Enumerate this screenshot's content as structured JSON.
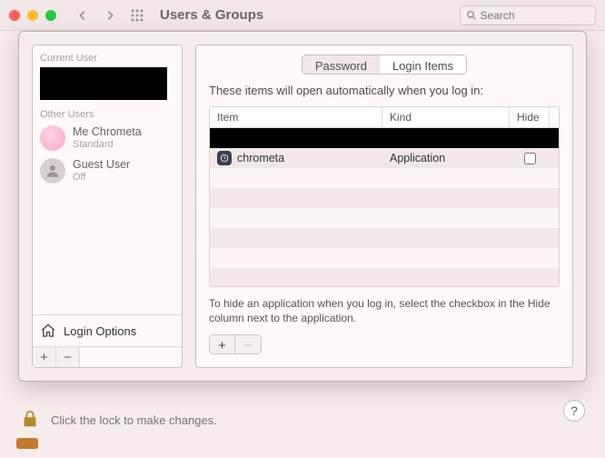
{
  "toolbar": {
    "title": "Users & Groups",
    "search_placeholder": "Search"
  },
  "sidebar": {
    "sections": {
      "current": "Current User",
      "other": "Other Users"
    },
    "users": [
      {
        "name": "Me Chrometa",
        "sub": "Standard"
      },
      {
        "name": "Guest User",
        "sub": "Off"
      }
    ],
    "login_options": "Login Options"
  },
  "main": {
    "tabs": {
      "password": "Password",
      "login_items": "Login Items"
    },
    "intro": "These items will open automatically when you log in:",
    "columns": {
      "item": "Item",
      "kind": "Kind",
      "hide": "Hide"
    },
    "rows": [
      {
        "name": "chrometa",
        "kind": "Application",
        "hide": false
      }
    ],
    "hint": "To hide an application when you log in, select the checkbox in the Hide column next to the application."
  },
  "footer": {
    "lock_text": "Click the lock to make changes.",
    "help": "?"
  }
}
